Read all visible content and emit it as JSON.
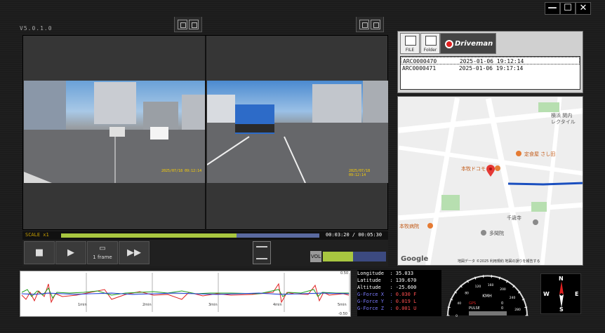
{
  "app": {
    "version": "V5.0.1.0",
    "window_controls": {
      "minimize": "—",
      "maximize": "☐",
      "close": "✕"
    }
  },
  "video": {
    "left_timestamp": "2025/07/18 09:12:14",
    "right_timestamp": "2025/07/18 09:12:14",
    "scale_label": "SCALE x1",
    "time_readout": "00:03:20 / 00:05:30",
    "progress": 0.68
  },
  "controls": {
    "stop": "■",
    "play": "▶",
    "frame_label": "1 frame",
    "fast_forward": "▶▶",
    "vol_label": "VOL",
    "volume": 0.48
  },
  "files": {
    "tabs": {
      "file": "FILE",
      "folder": "Folder"
    },
    "brand": "Driveman",
    "rows": [
      {
        "name": "ARC0000470",
        "datetime": "2025-01-06 19:12:14"
      },
      {
        "name": "ARC0000471",
        "datetime": "2025-01-06 19:17:14"
      }
    ]
  },
  "map": {
    "labels": {
      "place1": "横浜 関内",
      "place2": "レクタイル",
      "poi1": "定食屋 さし田",
      "poi2": "本牧ドコモ",
      "poi3": "本牧病院",
      "poi4": "千歳寺",
      "poi5": "多聞院"
    },
    "logo": "Google",
    "attribution": "地図データ ©2025  利用規約  地図の誤りを報告する"
  },
  "graph": {
    "y_max": "0.50",
    "y_min": "-0.50",
    "time_ticks": [
      "1min",
      "2min",
      "3min",
      "4min",
      "5min"
    ]
  },
  "gps": {
    "lines": [
      {
        "k": "Longitude  :",
        "v": " 35.033"
      },
      {
        "k": "Latitude   :",
        "v": " 139.670"
      },
      {
        "k": "Altitude   :",
        "v": " -25.600"
      },
      {
        "k": "G-Force X  :",
        "v": " 0.030 F"
      },
      {
        "k": "G-Force Y  :",
        "v": " 0.019 L"
      },
      {
        "k": "G-Force Z  :",
        "v": " 0.001 U"
      }
    ]
  },
  "speedometer": {
    "unit": "KMH",
    "gps_label": "GPS",
    "pulse_label": "PULSE",
    "gps_value": "0",
    "pulse_value": "0",
    "ticks": [
      "0",
      "20",
      "40",
      "60",
      "80",
      "100",
      "120",
      "140",
      "160",
      "180",
      "200",
      "220",
      "240",
      "260",
      "280",
      "300"
    ]
  },
  "compass": {
    "n": "N",
    "s": "S",
    "e": "E",
    "w": "W"
  }
}
